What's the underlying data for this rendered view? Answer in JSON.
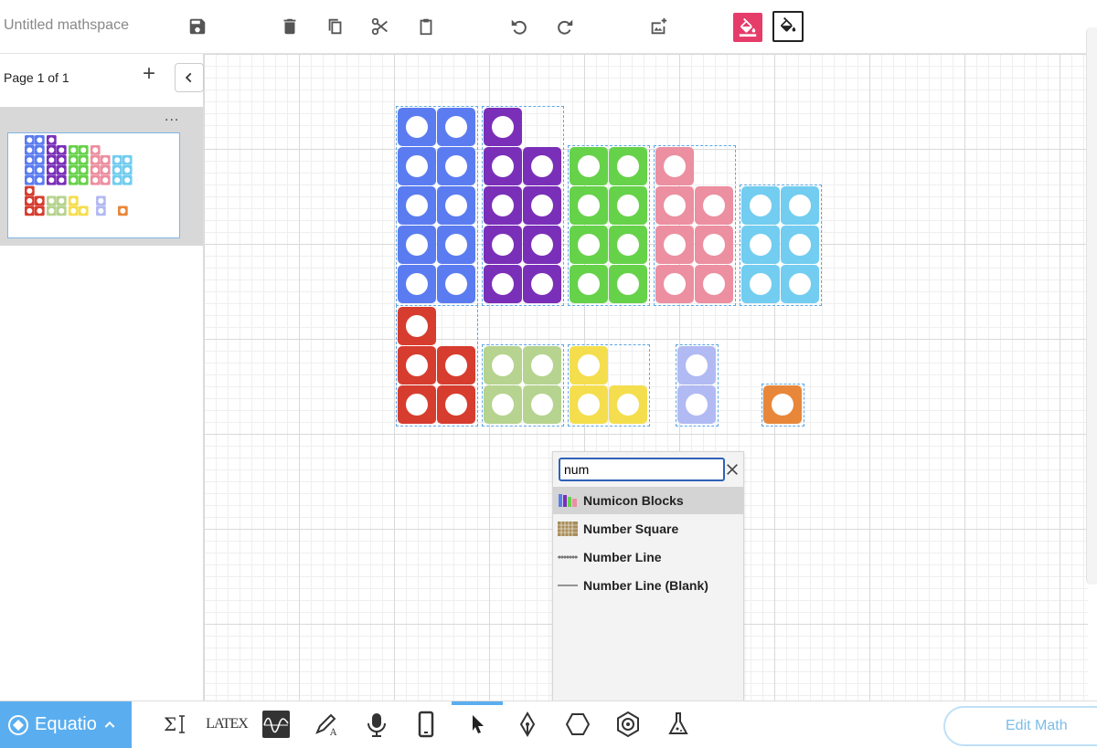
{
  "header": {
    "title": "Untitled mathspace",
    "icons": [
      "save-icon",
      "delete-icon",
      "copy-icon",
      "cut-icon",
      "paste-icon",
      "undo-icon",
      "redo-icon",
      "add-image-icon",
      "fill-color-icon",
      "fill-background-icon"
    ],
    "fill_active_color": "#e63c6a"
  },
  "sidebar": {
    "page_label": "Page 1 of 1",
    "add_label": "+",
    "more_label": "..."
  },
  "blocks": {
    "colors": {
      "ten": "#5b7cf0",
      "nine": "#7a2fb8",
      "eight": "#66d24a",
      "seven": "#ec8fa0",
      "six": "#72cdf0",
      "five": "#d63d2f",
      "four": "#b6d38f",
      "three": "#f5de4e",
      "two": "#b2baf3",
      "one": "#e8873a"
    }
  },
  "search": {
    "query": "num",
    "clear_icon": "close-icon",
    "results": [
      {
        "label": "Numicon Blocks",
        "icon": "numicon-thumbnail-icon",
        "selected": true
      },
      {
        "label": "Number Square",
        "icon": "number-square-thumbnail-icon",
        "selected": false
      },
      {
        "label": "Number Line",
        "icon": "number-line-thumbnail-icon",
        "selected": false
      },
      {
        "label": "Number Line (Blank)",
        "icon": "number-line-blank-thumbnail-icon",
        "selected": false
      }
    ]
  },
  "footer": {
    "brand": "Equatio",
    "latex_label": "LATEX",
    "edit_math": "Edit Math",
    "accent": "#5aaef0"
  }
}
